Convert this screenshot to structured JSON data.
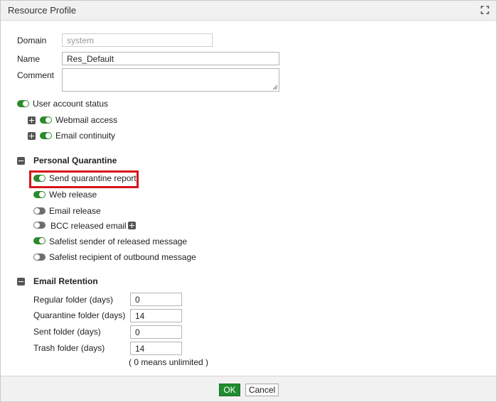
{
  "window": {
    "title": "Resource Profile",
    "expand_icon": "expand-icon"
  },
  "form": {
    "domain_label": "Domain",
    "domain_value": "system",
    "name_label": "Name",
    "name_value": "Res_Default",
    "comment_label": "Comment",
    "comment_value": ""
  },
  "user_account": {
    "status_label": "User account status",
    "status_on": true,
    "webmail_label": "Webmail access",
    "webmail_on": true,
    "continuity_label": "Email continuity",
    "continuity_on": true
  },
  "personal_quarantine": {
    "title": "Personal Quarantine",
    "items": [
      {
        "label": "Send quarantine report",
        "on": true,
        "highlighted": true
      },
      {
        "label": "Web release",
        "on": true
      },
      {
        "label": "Email release",
        "on": false
      },
      {
        "label": "BCC released email",
        "on": false
      },
      {
        "label": "Safelist sender of released message",
        "on": true
      },
      {
        "label": "Safelist recipient of outbound message",
        "on": false
      }
    ]
  },
  "email_retention": {
    "title": "Email Retention",
    "fields": [
      {
        "label": "Regular folder (days)",
        "value": "0"
      },
      {
        "label": "Quarantine folder (days)",
        "value": "14"
      },
      {
        "label": "Sent folder (days)",
        "value": "0"
      },
      {
        "label": "Trash folder (days)",
        "value": "14"
      }
    ],
    "note": "( 0 means unlimited )"
  },
  "footer": {
    "ok_label": "OK",
    "cancel_label": "Cancel"
  },
  "colors": {
    "toggle_on": "#2c8a2c",
    "toggle_off": "#6e6e6e",
    "highlight": "#d6141c",
    "ok_button": "#1f8c2f"
  }
}
